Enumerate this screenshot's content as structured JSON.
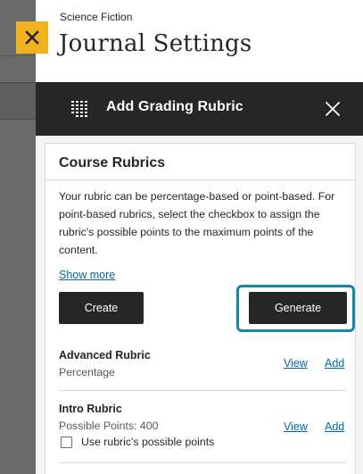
{
  "journal": {
    "breadcrumb": "Science Fiction",
    "title": "Journal Settings",
    "close_icon": "close-x-icon",
    "close_color": "#f2b21c"
  },
  "rubric_panel": {
    "title": "Add Grading Rubric",
    "icon": "rubric-grid-icon",
    "close_icon": "close-icon",
    "header_color": "#262626"
  },
  "course_rubrics": {
    "heading": "Course Rubrics",
    "description": "Your rubric can be percentage-based or point-based. For point-based rubrics, select the checkbox to assign the rubric's possible points to the maximum points of the content.",
    "show_more": "Show more",
    "create_label": "Create",
    "generate_label": "Generate",
    "highlight_color": "#1486a8",
    "link_color": "#006a9e",
    "items": [
      {
        "name": "Advanced Rubric",
        "detail": "Percentage",
        "view_label": "View",
        "add_label": "Add"
      },
      {
        "name": "Intro Rubric",
        "detail": "Possible Points: 400",
        "view_label": "View",
        "add_label": "Add",
        "checkbox_label": "Use rubric's possible points",
        "checkbox_checked": false
      }
    ]
  }
}
